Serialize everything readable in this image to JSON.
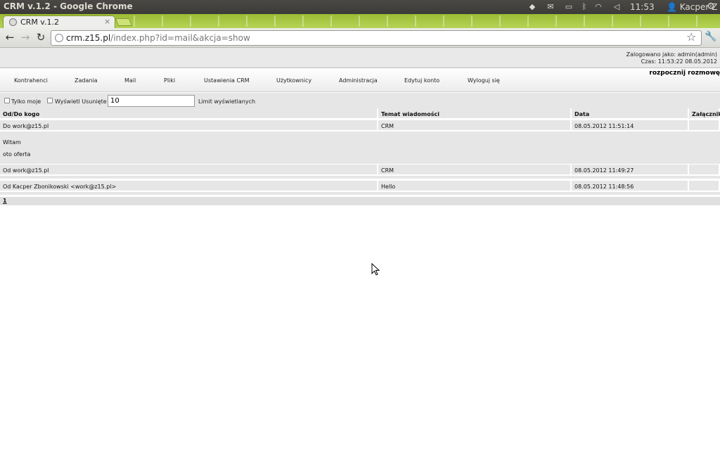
{
  "os": {
    "window_title": "CRM v.1.2 - Google Chrome",
    "clock": "11:53",
    "user": "Kacper Z"
  },
  "browser": {
    "tab_title": "CRM v.1.2",
    "tab_close": "×",
    "url_host": "crm.z15.pl",
    "url_path": "/index.php?id=mail&akcja=show"
  },
  "header": {
    "logged_as": "Zalogowano jako: admin(admin)",
    "time": "Czas: 11:53:22 08.05.2012",
    "chat_link": "rozpocznij rozmowę"
  },
  "menu": {
    "items": [
      "Kontrahenci",
      "Zadania",
      "Mail",
      "Pliki",
      "Ustawienia CRM",
      "Użytkownicy",
      "Administracja",
      "Edytuj konto",
      "Wyloguj się"
    ]
  },
  "filters": {
    "only_mine_label": "Tylko moje",
    "show_deleted_label": "Wyświetl Usunięte",
    "limit_value": "10",
    "limit_label": "Limit wyświetlanych"
  },
  "table": {
    "headers": [
      "Od/Do kogo",
      "Temat wiadomości",
      "Data",
      "Załącznik"
    ],
    "rows": [
      {
        "who": "Do work@z15.pl",
        "subject": "CRM",
        "date": "08.05.2012 11:51:14",
        "attachment": "",
        "body": [
          "Witam",
          "oto oferta"
        ]
      },
      {
        "who": "Od work@z15.pl",
        "subject": "CRM",
        "date": "08.05.2012 11:49:27",
        "attachment": ""
      },
      {
        "who": "Od Kacper Zbonikowski <work@z15.pl>",
        "subject": "Hello",
        "date": "08.05.2012 11:48:56",
        "attachment": ""
      }
    ]
  },
  "pagination": {
    "current": "1"
  }
}
